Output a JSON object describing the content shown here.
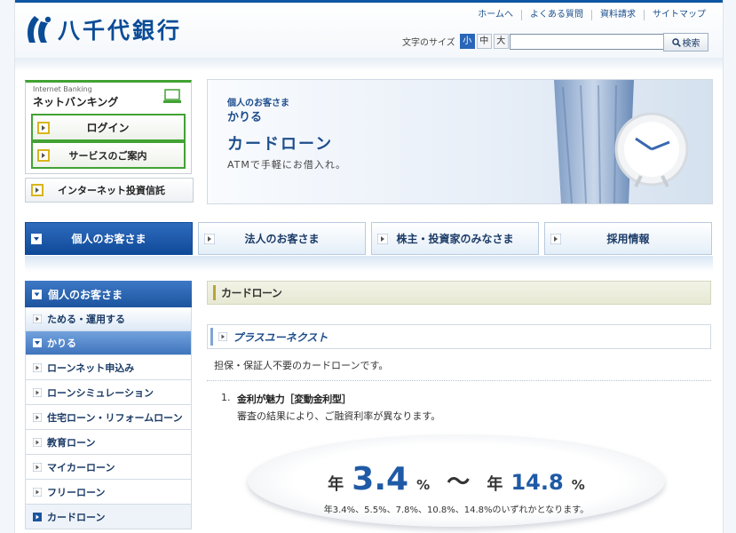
{
  "brand": {
    "name": "八千代銀行"
  },
  "utility_nav": [
    "ホームへ",
    "よくある質問",
    "資料請求",
    "サイトマップ"
  ],
  "text_size": {
    "label": "文字のサイズ",
    "options": [
      "小",
      "中",
      "大"
    ],
    "selected": "小"
  },
  "search": {
    "value": "",
    "button_label": "検索"
  },
  "net_banking": {
    "label_en": "Internet Banking",
    "title": "ネットバンキング",
    "login_label": "ログイン",
    "service_label": "サービスのご案内"
  },
  "investment_trust_label": "インターネット投資信託",
  "hero": {
    "small": "個人のお客さま",
    "sub": "かりる",
    "title": "カードローン",
    "desc": "ATMで手軽にお借入れ。"
  },
  "global_nav": [
    "個人のお客さま",
    "法人のお客さま",
    "株主・投資家のみなさま",
    "採用情報"
  ],
  "sidebar": {
    "header": "個人のお客さま",
    "items": [
      {
        "label": "ためる・運用する"
      },
      {
        "label": "かりる"
      },
      {
        "label": "ローンネット申込み"
      },
      {
        "label": "ローンシミュレーション"
      },
      {
        "label": "住宅ローン・リフォームローン"
      },
      {
        "label": "教育ローン"
      },
      {
        "label": "マイカーローン"
      },
      {
        "label": "フリーローン"
      },
      {
        "label": "カードローン"
      }
    ]
  },
  "content": {
    "page_title": "カードローン",
    "section_title": "プラスユーネクスト",
    "intro": "担保・保証人不要のカードローンです。",
    "feature": {
      "number": "1.",
      "title": "金利が魅力［変動金利型］",
      "desc": "審査の結果により、ご融資利率が異なります。"
    },
    "rate": {
      "prefix": "年",
      "min": "3.4",
      "percent": "%",
      "tilde": "〜",
      "max": "14.8",
      "note": "年3.4%、5.5%、7.8%、10.8%、14.8%のいずれかとなります。"
    }
  },
  "colors": {
    "brand_blue": "#0a4c96",
    "nav_active": "#1c549e",
    "netbank_green": "#42a234",
    "arrow_yellow": "#d9b51c",
    "title_bar": "#e7e9d4"
  },
  "icons": [
    "logo-mark-icon",
    "search-icon",
    "pc-icon",
    "arrow-right-icon",
    "arrow-down-icon",
    "clock-icon",
    "vase-icon"
  ]
}
